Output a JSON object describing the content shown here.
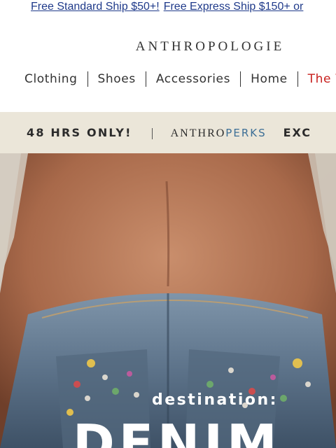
{
  "shipping": {
    "standard": "Free Standard Ship $50+!",
    "express": "Free Express Ship $150+ or"
  },
  "brand": {
    "logo": "ANTHROPOLOGIE"
  },
  "nav": {
    "items": [
      "Clothing",
      "Shoes",
      "Accessories",
      "Home",
      "The V-"
    ]
  },
  "promo": {
    "duration": "48 HRS ONLY!",
    "anthro": "ANTHRO",
    "perks": "PERKS",
    "trailing": "EXC"
  },
  "hero": {
    "kicker": "destination:",
    "headline": "DENIM"
  },
  "colors": {
    "link": "#1f3a8a",
    "nav_accent": "#c8201e",
    "promo_bg": "#ebe6d9",
    "perks_blue": "#3d6f96"
  }
}
